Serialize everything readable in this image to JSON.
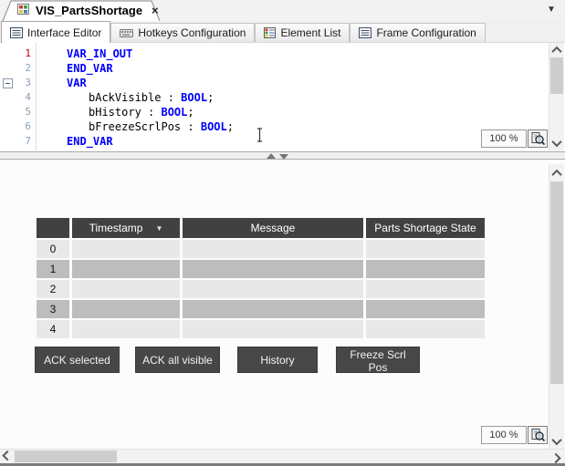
{
  "window": {
    "doc_tab": {
      "title": "VIS_PartsShortage"
    }
  },
  "icons": {
    "close": "×",
    "tab_list_dropdown": "▼",
    "sort_desc": "▼"
  },
  "subtabs": [
    {
      "label": "Interface Editor",
      "active": true
    },
    {
      "label": "Hotkeys Configuration",
      "active": false
    },
    {
      "label": "Element List",
      "active": false
    },
    {
      "label": "Frame Configuration",
      "active": false
    }
  ],
  "editor": {
    "zoom_level": "100 %",
    "lines": [
      {
        "n": "1",
        "k1": "VAR_IN_OUT"
      },
      {
        "n": "2",
        "k1": "END_VAR"
      },
      {
        "n": "3",
        "k1": "VAR"
      },
      {
        "n": "4",
        "id": "bAckVisible",
        "sep": " : ",
        "type": "BOOL",
        "end": ";"
      },
      {
        "n": "5",
        "id": "bHistory",
        "sep": " : ",
        "type": "BOOL",
        "end": ";"
      },
      {
        "n": "6",
        "id": "bFreezeScrlPos",
        "sep": " : ",
        "type": "BOOL",
        "end": ";"
      },
      {
        "n": "7",
        "k1": "END_VAR"
      }
    ]
  },
  "viz": {
    "zoom_level": "100 %",
    "table": {
      "headers": {
        "index": "",
        "timestamp": "Timestamp",
        "message": "Message",
        "state": "Parts Shortage State"
      },
      "sorted_column": "Timestamp",
      "sort_direction": "desc",
      "rows": [
        {
          "index": "0",
          "timestamp": "",
          "message": "",
          "state": ""
        },
        {
          "index": "1",
          "timestamp": "",
          "message": "",
          "state": ""
        },
        {
          "index": "2",
          "timestamp": "",
          "message": "",
          "state": ""
        },
        {
          "index": "3",
          "timestamp": "",
          "message": "",
          "state": ""
        },
        {
          "index": "4",
          "timestamp": "",
          "message": "",
          "state": ""
        }
      ]
    },
    "buttons": [
      {
        "label": "ACK selected"
      },
      {
        "label": "ACK all visible"
      },
      {
        "label": "History"
      },
      {
        "label": "Freeze Scrl Pos"
      }
    ]
  },
  "colors": {
    "keyword": "#0000ff",
    "identifier": "#000000",
    "line_number": "#8ca0b4",
    "current_line_number": "#c00000",
    "table_header_bg": "#414141",
    "row_light": "#e8e8e8",
    "row_dark": "#bdbdbd",
    "button_bg": "#474747",
    "button_text": "#ffffff"
  }
}
